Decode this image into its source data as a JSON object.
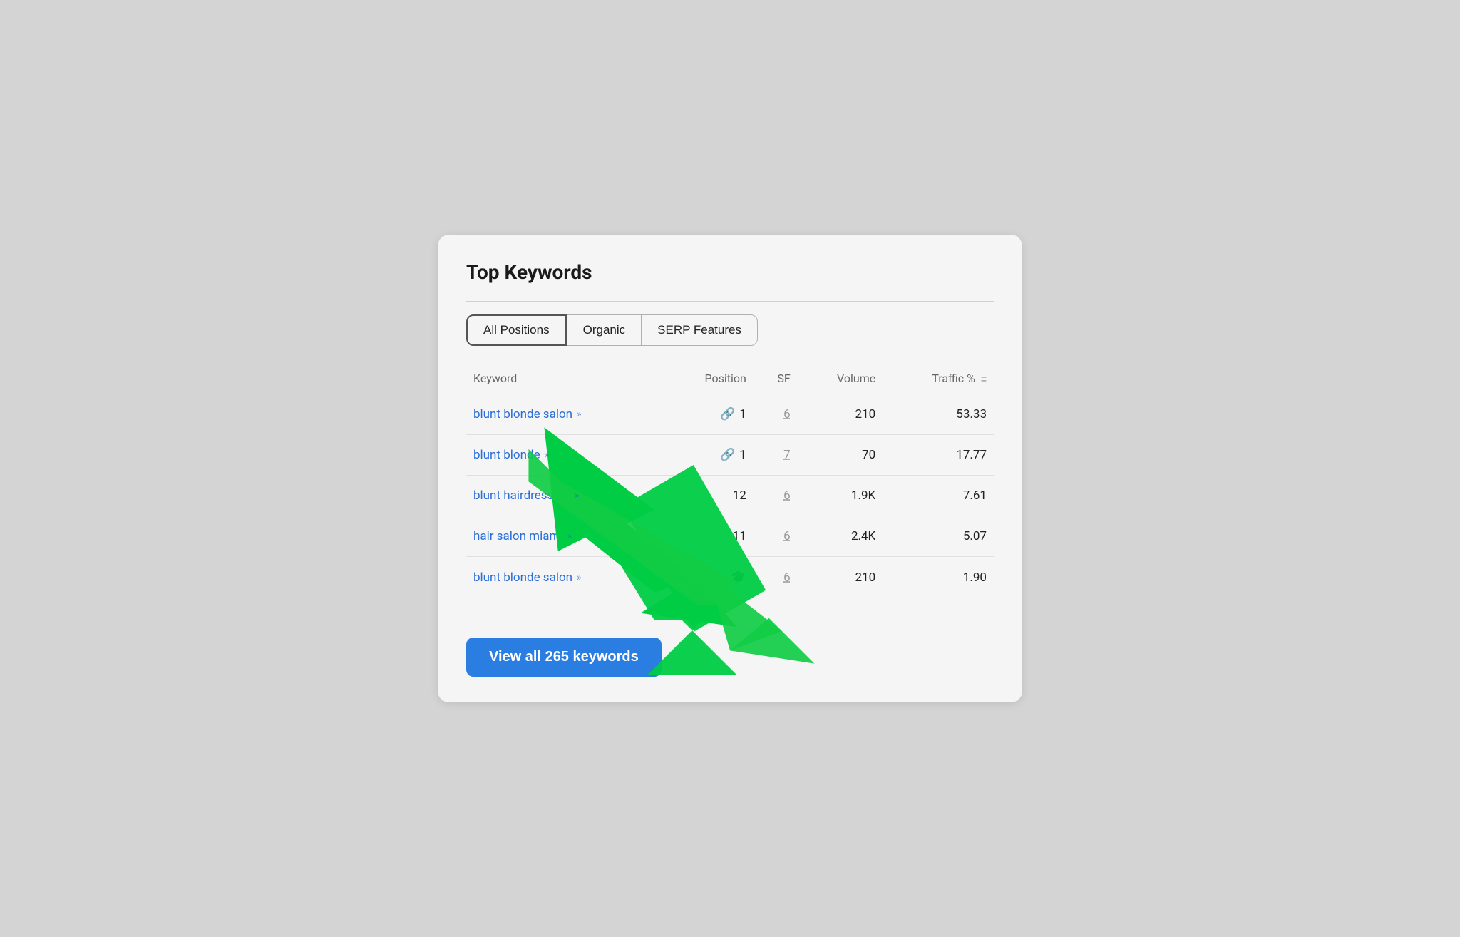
{
  "card": {
    "title": "Top Keywords"
  },
  "tabs": [
    {
      "id": "all-positions",
      "label": "All Positions",
      "active": true
    },
    {
      "id": "organic",
      "label": "Organic",
      "active": false
    },
    {
      "id": "serp-features",
      "label": "SERP Features",
      "active": false
    }
  ],
  "table": {
    "columns": [
      {
        "id": "keyword",
        "label": "Keyword"
      },
      {
        "id": "position",
        "label": "Position"
      },
      {
        "id": "sf",
        "label": "SF"
      },
      {
        "id": "volume",
        "label": "Volume"
      },
      {
        "id": "traffic",
        "label": "Traffic %"
      }
    ],
    "rows": [
      {
        "keyword": "blunt blonde salon",
        "position_icon": "link",
        "position": "1",
        "sf": "6",
        "volume": "210",
        "traffic": "53.33"
      },
      {
        "keyword": "blunt blonde",
        "position_icon": "link",
        "position": "1",
        "sf": "7",
        "volume": "70",
        "traffic": "17.77"
      },
      {
        "keyword": "blunt hairdressers",
        "position_icon": "none",
        "position": "12",
        "sf": "6",
        "volume": "1.9K",
        "traffic": "7.61"
      },
      {
        "keyword": "hair salon miami",
        "position_icon": "none",
        "position": "11",
        "sf": "6",
        "volume": "2.4K",
        "traffic": "5.07"
      },
      {
        "keyword": "blunt blonde salon",
        "position_icon": "graduation",
        "position": "",
        "sf": "6",
        "volume": "210",
        "traffic": "1.90"
      }
    ]
  },
  "view_button": {
    "label": "View all 265 keywords"
  },
  "colors": {
    "accent_blue": "#2a7de1",
    "keyword_blue": "#2a6dd9",
    "icon_navy": "#1a3d8f"
  }
}
